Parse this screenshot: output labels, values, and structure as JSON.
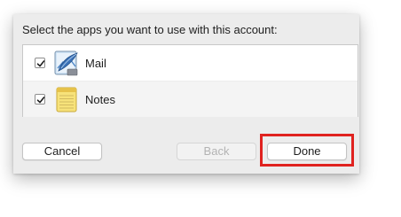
{
  "dialog": {
    "prompt": "Select the apps you want to use with this account:",
    "apps": [
      {
        "label": "Mail",
        "checked": true,
        "icon": "mail-icon"
      },
      {
        "label": "Notes",
        "checked": true,
        "icon": "notes-icon"
      }
    ],
    "buttons": {
      "cancel": "Cancel",
      "back": "Back",
      "done": "Done"
    }
  },
  "colors": {
    "highlight": "#e0221f",
    "dialog_bg": "#ececec"
  }
}
